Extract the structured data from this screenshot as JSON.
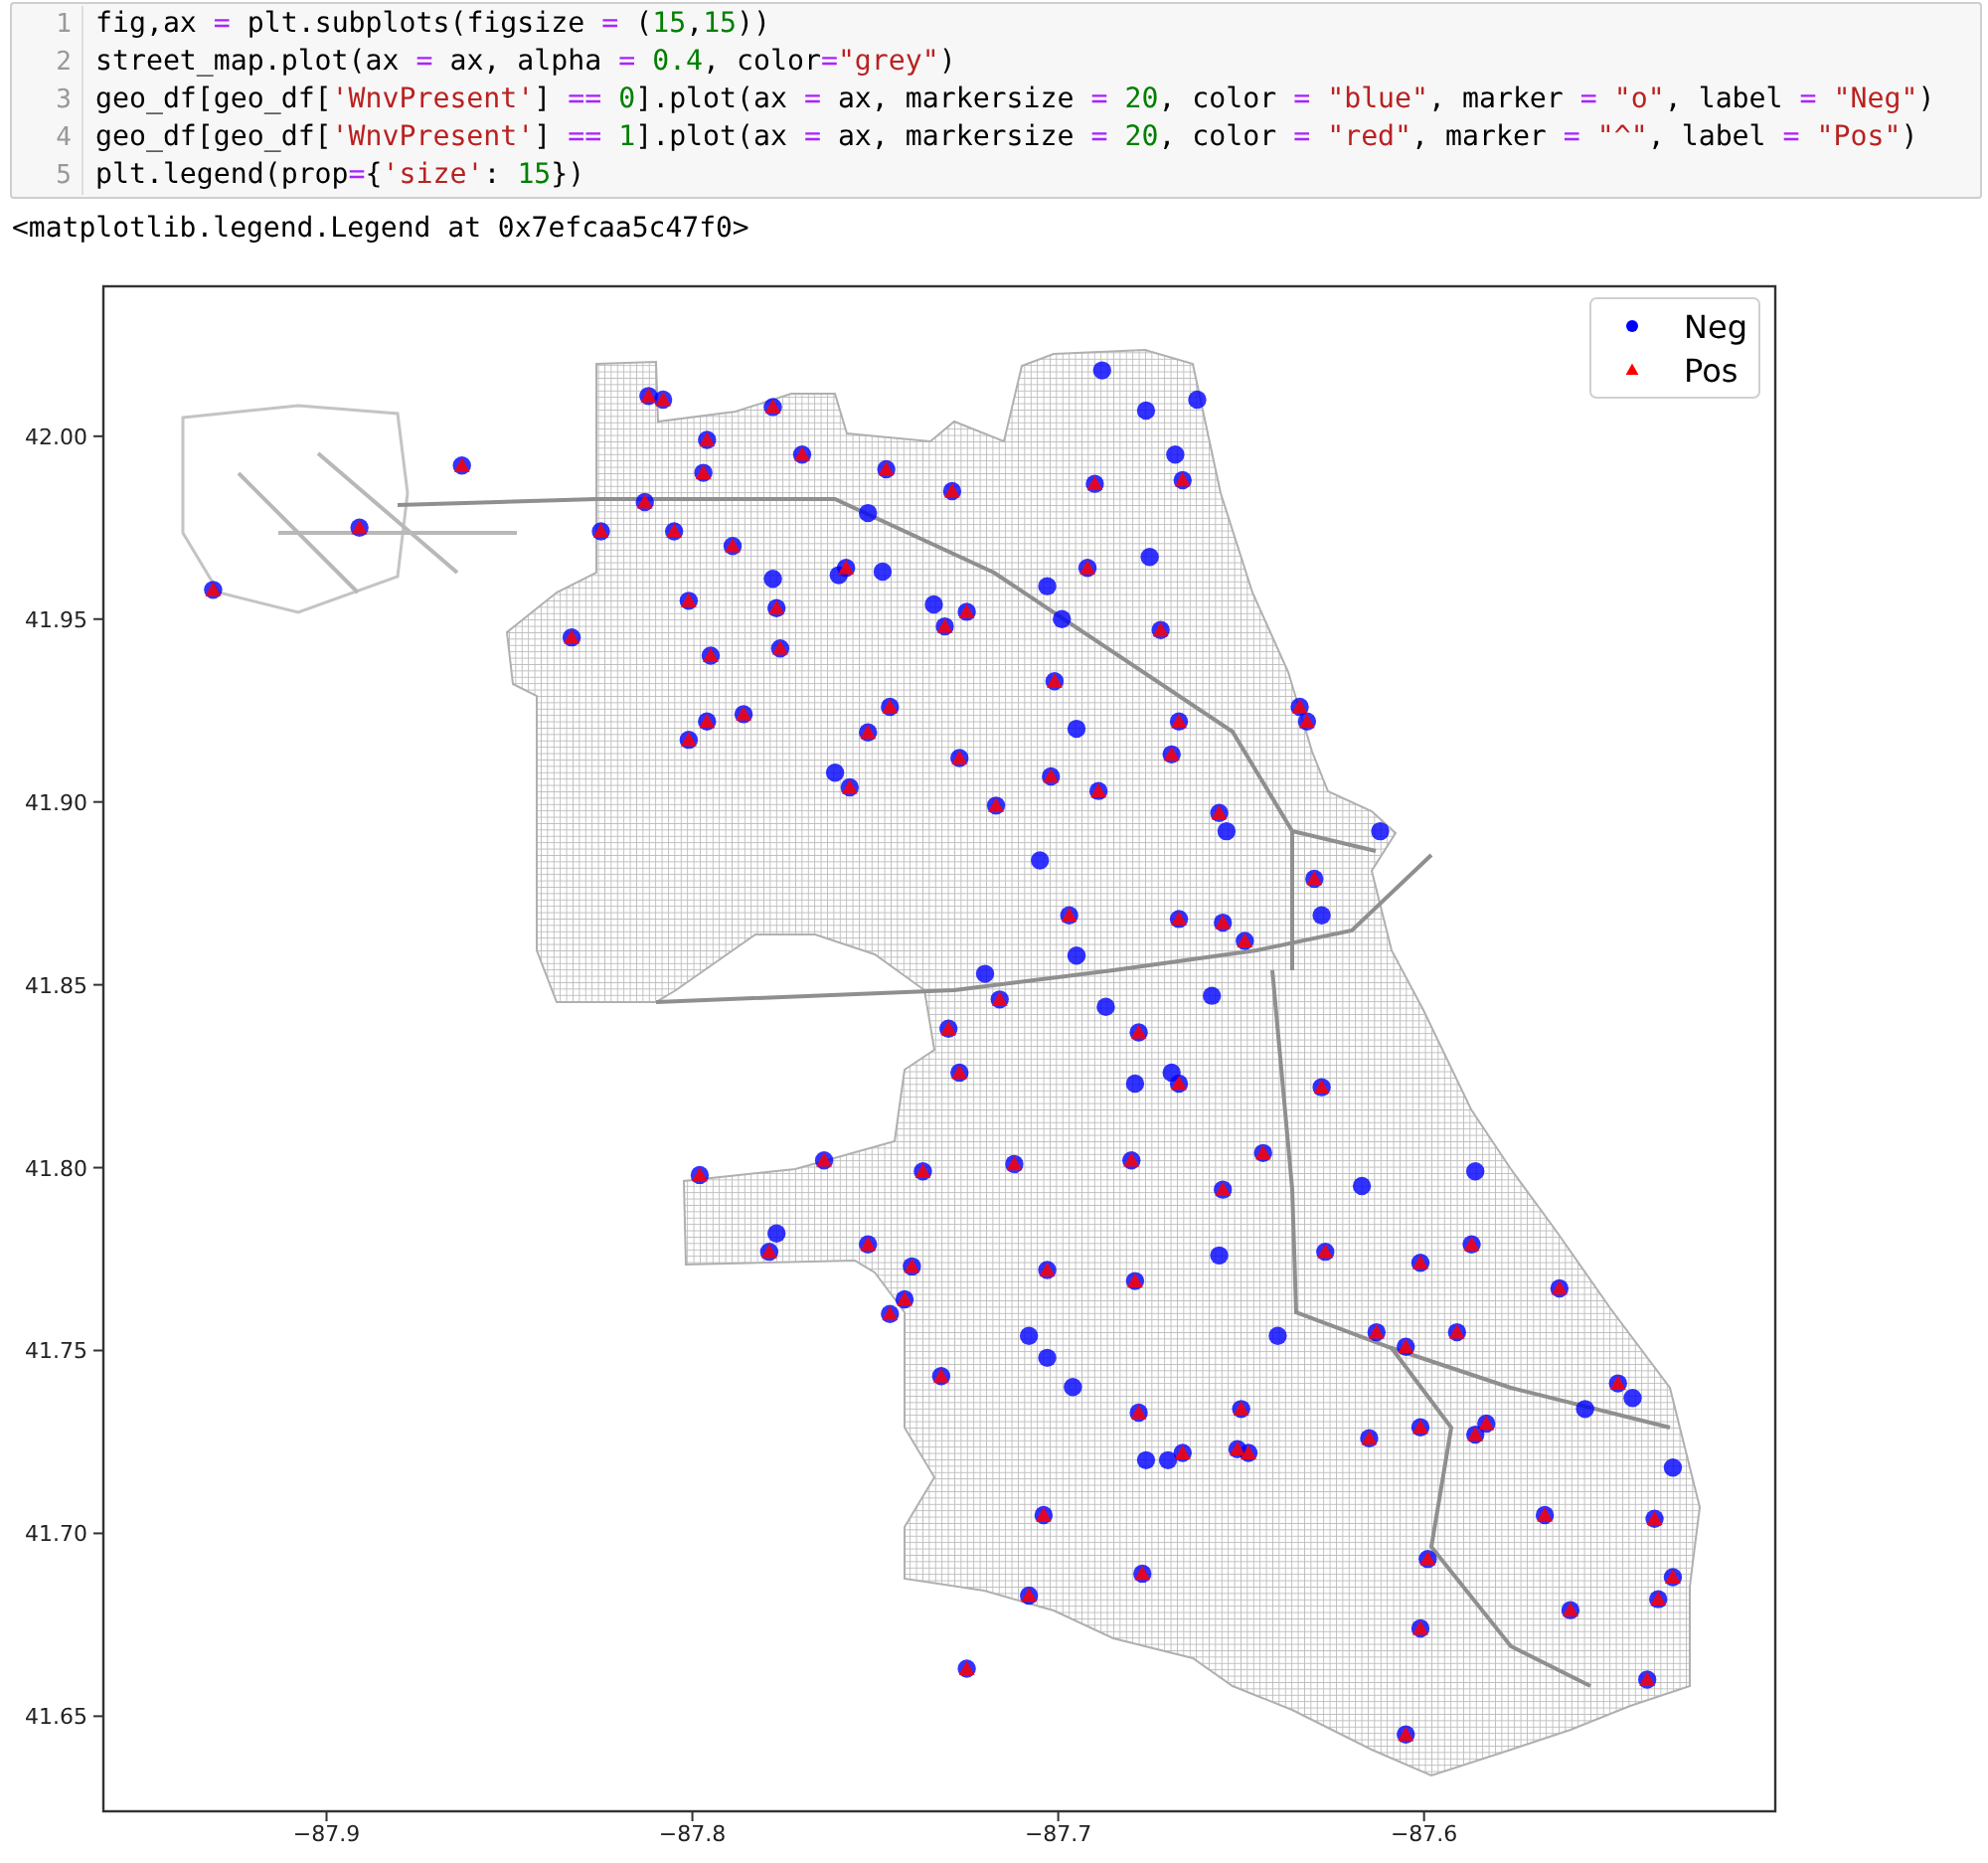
{
  "code_cell": {
    "lines": [
      {
        "number": "1",
        "code": "fig,ax = plt.subplots(figsize = (15,15))"
      },
      {
        "number": "2",
        "code": "street_map.plot(ax = ax, alpha = 0.4, color=\"grey\")"
      },
      {
        "number": "3",
        "code": "geo_df[geo_df['WnvPresent'] == 0].plot(ax = ax, markersize = 20, color = \"blue\", marker = \"o\", label = \"Neg\")"
      },
      {
        "number": "4",
        "code": "geo_df[geo_df['WnvPresent'] == 1].plot(ax = ax, markersize = 20, color = \"red\", marker = \"^\", label = \"Pos\")"
      },
      {
        "number": "5",
        "code": "plt.legend(prop={'size': 15})"
      }
    ]
  },
  "output": {
    "text": "<matplotlib.legend.Legend at 0x7efcaa5c47f0>"
  },
  "plot": {
    "chart_data": {
      "type": "scatter",
      "legend": true,
      "xlim": [
        -87.961,
        -87.504
      ],
      "ylim": [
        41.624,
        42.041
      ],
      "xticks": [
        {
          "value": -87.9,
          "label": "−87.9"
        },
        {
          "value": -87.8,
          "label": "−87.8"
        },
        {
          "value": -87.7,
          "label": "−87.7"
        },
        {
          "value": -87.6,
          "label": "−87.6"
        }
      ],
      "yticks": [
        {
          "value": 41.65,
          "label": "41.65"
        },
        {
          "value": 41.7,
          "label": "41.70"
        },
        {
          "value": 41.75,
          "label": "41.75"
        },
        {
          "value": 41.8,
          "label": "41.80"
        },
        {
          "value": 41.85,
          "label": "41.85"
        },
        {
          "value": 41.9,
          "label": "41.90"
        },
        {
          "value": 41.95,
          "label": "41.95"
        },
        {
          "value": 42.0,
          "label": "42.00"
        }
      ],
      "series": [
        {
          "name": "Neg",
          "color": "#0000ff",
          "x": [
            -87.931,
            -87.863,
            -87.891,
            -87.812,
            -87.808,
            -87.778,
            -87.796,
            -87.797,
            -87.77,
            -87.747,
            -87.813,
            -87.825,
            -87.805,
            -87.789,
            -87.752,
            -87.729,
            -87.778,
            -87.76,
            -87.758,
            -87.748,
            -87.777,
            -87.801,
            -87.833,
            -87.795,
            -87.776,
            -87.734,
            -87.731,
            -87.746,
            -87.786,
            -87.796,
            -87.801,
            -87.752,
            -87.761,
            -87.757,
            -87.73,
            -87.688,
            -87.662,
            -87.676,
            -87.668,
            -87.69,
            -87.666,
            -87.675,
            -87.692,
            -87.703,
            -87.725,
            -87.699,
            -87.672,
            -87.701,
            -87.634,
            -87.632,
            -87.667,
            -87.695,
            -87.669,
            -87.727,
            -87.702,
            -87.689,
            -87.717,
            -87.656,
            -87.654,
            -87.612,
            -87.705,
            -87.63,
            -87.628,
            -87.697,
            -87.667,
            -87.655,
            -87.649,
            -87.695,
            -87.72,
            -87.716,
            -87.687,
            -87.658,
            -87.678,
            -87.798,
            -87.764,
            -87.737,
            -87.777,
            -87.779,
            -87.752,
            -87.74,
            -87.742,
            -87.746,
            -87.732,
            -87.727,
            -87.679,
            -87.669,
            -87.667,
            -87.628,
            -87.712,
            -87.68,
            -87.644,
            -87.586,
            -87.617,
            -87.655,
            -87.587,
            -87.656,
            -87.627,
            -87.703,
            -87.601,
            -87.679,
            -87.563,
            -87.708,
            -87.703,
            -87.64,
            -87.613,
            -87.605,
            -87.591,
            -87.696,
            -87.547,
            -87.543,
            -87.556,
            -87.678,
            -87.65,
            -87.601,
            -87.583,
            -87.586,
            -87.615,
            -87.676,
            -87.67,
            -87.666,
            -87.651,
            -87.648,
            -87.532,
            -87.704,
            -87.567,
            -87.537,
            -87.599,
            -87.677,
            -87.708,
            -87.532,
            -87.536,
            -87.56,
            -87.601,
            -87.725,
            -87.539,
            -87.605
          ],
          "values": [
            41.958,
            41.992,
            41.975,
            42.011,
            42.01,
            42.008,
            41.999,
            41.99,
            41.995,
            41.991,
            41.982,
            41.974,
            41.974,
            41.97,
            41.979,
            41.985,
            41.961,
            41.962,
            41.964,
            41.963,
            41.953,
            41.955,
            41.945,
            41.94,
            41.942,
            41.954,
            41.948,
            41.926,
            41.924,
            41.922,
            41.917,
            41.919,
            41.908,
            41.904,
            41.838,
            42.018,
            42.01,
            42.007,
            41.995,
            41.987,
            41.988,
            41.967,
            41.964,
            41.959,
            41.952,
            41.95,
            41.947,
            41.933,
            41.926,
            41.922,
            41.922,
            41.92,
            41.913,
            41.912,
            41.907,
            41.903,
            41.899,
            41.897,
            41.892,
            41.892,
            41.884,
            41.879,
            41.869,
            41.869,
            41.868,
            41.867,
            41.862,
            41.858,
            41.853,
            41.846,
            41.844,
            41.847,
            41.837,
            41.798,
            41.802,
            41.799,
            41.782,
            41.777,
            41.779,
            41.773,
            41.764,
            41.76,
            41.743,
            41.826,
            41.823,
            41.826,
            41.823,
            41.822,
            41.801,
            41.802,
            41.804,
            41.799,
            41.795,
            41.794,
            41.779,
            41.776,
            41.777,
            41.772,
            41.774,
            41.769,
            41.767,
            41.754,
            41.748,
            41.754,
            41.755,
            41.751,
            41.755,
            41.74,
            41.741,
            41.737,
            41.734,
            41.733,
            41.734,
            41.729,
            41.73,
            41.727,
            41.726,
            41.72,
            41.72,
            41.722,
            41.723,
            41.722,
            41.718,
            41.705,
            41.705,
            41.704,
            41.693,
            41.689,
            41.683,
            41.688,
            41.682,
            41.679,
            41.674,
            41.663,
            41.66,
            41.645
          ]
        },
        {
          "name": "Pos",
          "color": "#ff0000",
          "x": [
            -87.931,
            -87.863,
            -87.891,
            -87.812,
            -87.808,
            -87.778,
            -87.796,
            -87.797,
            -87.77,
            -87.747,
            -87.813,
            -87.825,
            -87.805,
            -87.789,
            -87.729,
            -87.758,
            -87.777,
            -87.801,
            -87.833,
            -87.795,
            -87.776,
            -87.731,
            -87.746,
            -87.786,
            -87.796,
            -87.801,
            -87.752,
            -87.757,
            -87.73,
            -87.69,
            -87.666,
            -87.692,
            -87.725,
            -87.672,
            -87.701,
            -87.634,
            -87.632,
            -87.667,
            -87.669,
            -87.727,
            -87.702,
            -87.689,
            -87.717,
            -87.656,
            -87.63,
            -87.697,
            -87.667,
            -87.655,
            -87.649,
            -87.716,
            -87.678,
            -87.798,
            -87.764,
            -87.737,
            -87.779,
            -87.752,
            -87.74,
            -87.742,
            -87.746,
            -87.732,
            -87.727,
            -87.667,
            -87.628,
            -87.712,
            -87.68,
            -87.644,
            -87.655,
            -87.587,
            -87.627,
            -87.703,
            -87.601,
            -87.679,
            -87.563,
            -87.613,
            -87.605,
            -87.591,
            -87.547,
            -87.678,
            -87.65,
            -87.601,
            -87.583,
            -87.586,
            -87.615,
            -87.666,
            -87.651,
            -87.648,
            -87.704,
            -87.567,
            -87.537,
            -87.599,
            -87.677,
            -87.708,
            -87.532,
            -87.536,
            -87.56,
            -87.601,
            -87.725,
            -87.539,
            -87.605
          ],
          "values": [
            41.958,
            41.992,
            41.975,
            42.011,
            42.01,
            42.008,
            41.999,
            41.99,
            41.995,
            41.991,
            41.982,
            41.974,
            41.974,
            41.97,
            41.985,
            41.964,
            41.953,
            41.955,
            41.945,
            41.94,
            41.942,
            41.948,
            41.926,
            41.924,
            41.922,
            41.917,
            41.919,
            41.904,
            41.838,
            41.987,
            41.988,
            41.964,
            41.952,
            41.947,
            41.933,
            41.926,
            41.922,
            41.922,
            41.913,
            41.912,
            41.907,
            41.903,
            41.899,
            41.897,
            41.879,
            41.869,
            41.868,
            41.867,
            41.862,
            41.846,
            41.837,
            41.798,
            41.802,
            41.799,
            41.777,
            41.779,
            41.773,
            41.764,
            41.76,
            41.743,
            41.826,
            41.823,
            41.822,
            41.801,
            41.802,
            41.804,
            41.794,
            41.779,
            41.777,
            41.772,
            41.774,
            41.769,
            41.767,
            41.755,
            41.751,
            41.755,
            41.741,
            41.733,
            41.734,
            41.729,
            41.73,
            41.727,
            41.726,
            41.722,
            41.723,
            41.722,
            41.705,
            41.705,
            41.704,
            41.693,
            41.689,
            41.683,
            41.688,
            41.682,
            41.679,
            41.674,
            41.663,
            41.66,
            41.645
          ]
        }
      ]
    }
  }
}
